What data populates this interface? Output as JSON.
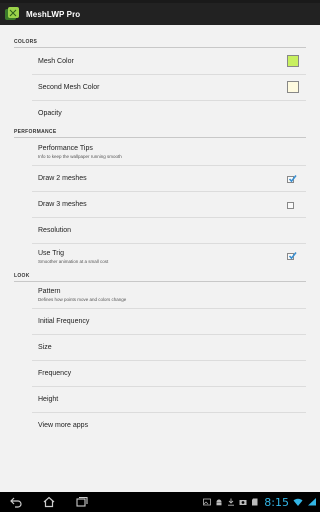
{
  "app": {
    "title": "MeshLWP Pro"
  },
  "sections": {
    "colors": "COLORS",
    "performance": "PERFORMANCE",
    "look": "LOOK"
  },
  "prefs": {
    "mesh_color": {
      "title": "Mesh Color",
      "swatch": "#c8f060"
    },
    "second_mesh_color": {
      "title": "Second Mesh Color",
      "swatch": "#fffbe0"
    },
    "opacity": {
      "title": "Opacity"
    },
    "performance_tips": {
      "title": "Performance Tips",
      "summary": "Info to keep the wallpaper running smooth"
    },
    "draw_2_meshes": {
      "title": "Draw 2 meshes",
      "checked": true
    },
    "draw_3_meshes": {
      "title": "Draw 3 meshes",
      "checked": false
    },
    "resolution": {
      "title": "Resolution"
    },
    "use_trig": {
      "title": "Use Trig",
      "summary": "Smoother animation at a small cost",
      "checked": true
    },
    "pattern": {
      "title": "Pattern",
      "summary": "Defines how points move and colors change"
    },
    "initial_frequency": {
      "title": "Initial Frequency"
    },
    "size": {
      "title": "Size"
    },
    "frequency": {
      "title": "Frequency"
    },
    "height": {
      "title": "Height"
    },
    "view_more_apps": {
      "title": "View more apps"
    }
  },
  "statusbar": {
    "time": "8:15"
  },
  "colors": {
    "accent": "#33b5e5",
    "actionbar": "#222222",
    "check": "#3a8fd0"
  }
}
